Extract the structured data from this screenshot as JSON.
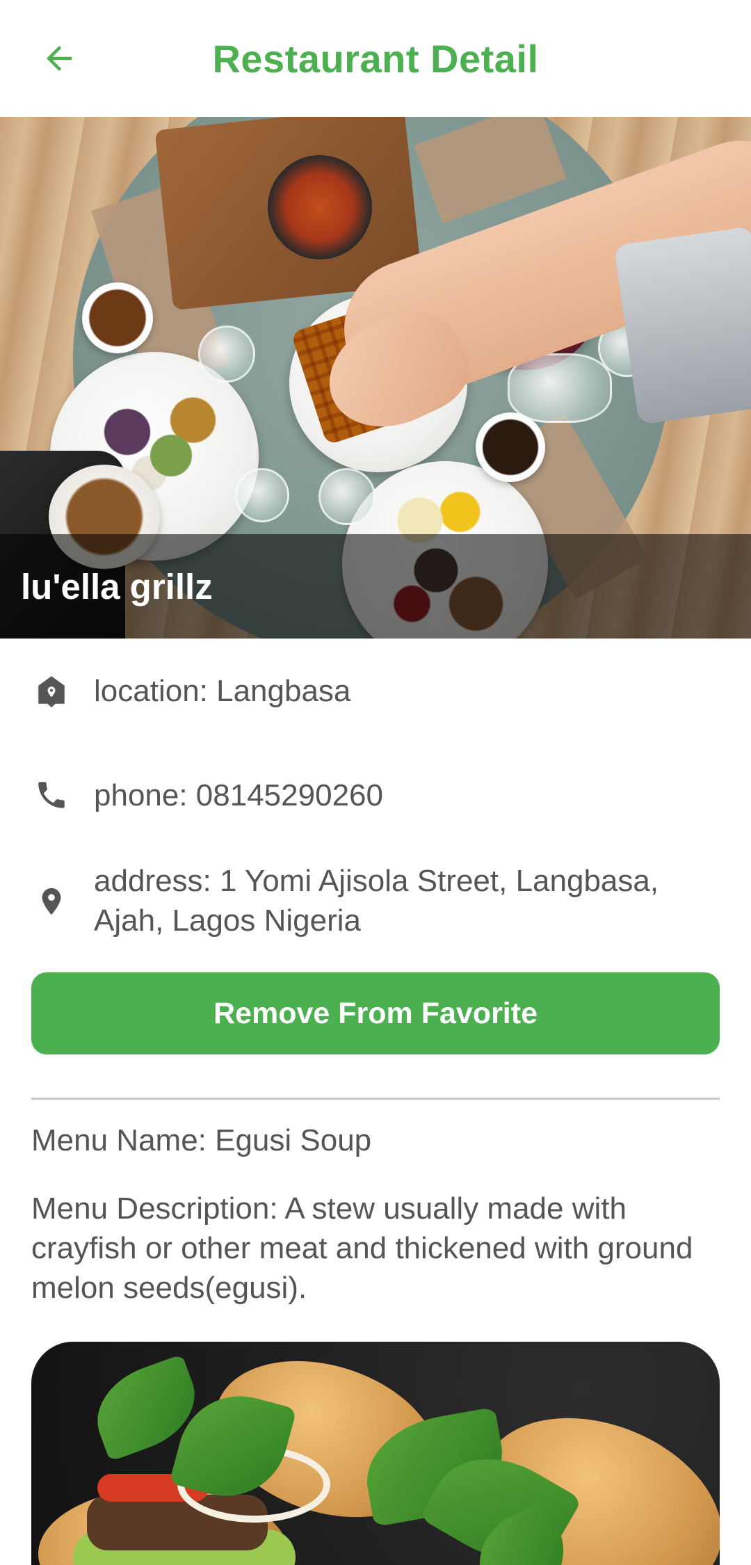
{
  "header": {
    "title": "Restaurant Detail",
    "back_icon": "arrow-back-icon",
    "accent_color": "#4caf50"
  },
  "restaurant": {
    "name": "lu'ella grillz",
    "location": "location: Langbasa",
    "phone": "phone: 08145290260",
    "address": "address: 1 Yomi Ajisola Street, Langbasa, Ajah, Lagos Nigeria"
  },
  "icons": {
    "location": "home-pin-icon",
    "phone": "phone-icon",
    "address": "map-pin-icon"
  },
  "actions": {
    "favorite_label": "Remove From Favorite"
  },
  "menu": {
    "name": "Menu Name: Egusi Soup",
    "description": "Menu Description: A stew usually made with crayfish or other meat and thickened with ground melon seeds(egusi)."
  }
}
